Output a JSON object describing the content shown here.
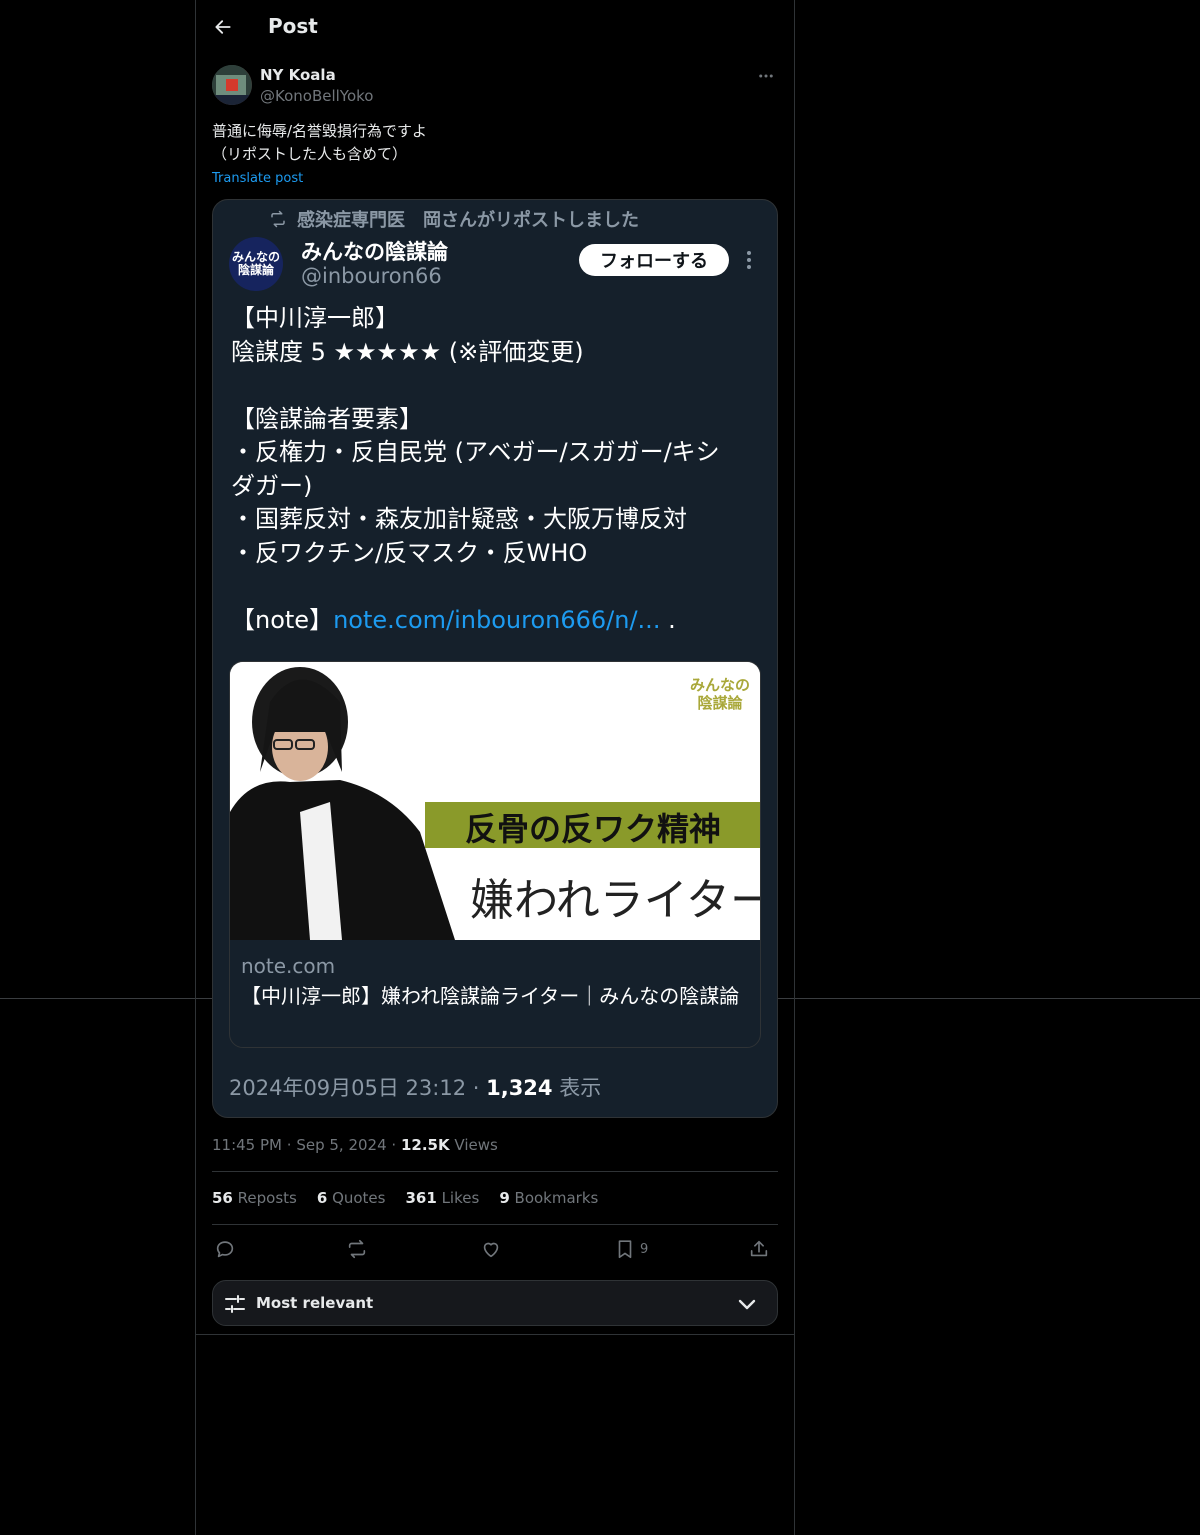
{
  "header": {
    "title": "Post"
  },
  "author": {
    "name": "NY Koala",
    "handle": "@KonoBellYoko"
  },
  "post": {
    "lines": [
      "普通に侮辱/名誉毀損行為ですよ",
      "（リポストした人も含めて）"
    ],
    "translate": "Translate post"
  },
  "screenshot": {
    "repost_label": "感染症専門医　岡さんがリポストしました",
    "avatar_text": "みんなの陰謀論",
    "name": "みんなの陰謀論",
    "handle": "@inbouron66",
    "follow": "フォローする",
    "text": {
      "l1": "【中川淳一郎】",
      "l2": "陰謀度 5 ★★★★★ (※評価変更)",
      "l3": "【陰謀論者要素】",
      "l4": "・反権力・反自民党 (アベガー/スガガー/キシ",
      "l5": "ダガー)",
      "l6": "・国葬反対・森友加計疑惑・大阪万博反対",
      "l7": "・反ワクチン/反マスク・反WHO",
      "note_prefix": "【note】",
      "note_link": "note.com/inbouron666/n/...",
      "note_suffix": " ."
    },
    "card": {
      "logo": "みんなの陰謀論",
      "banner": "反骨の反ワク精神",
      "subtitle": "嫌われライター",
      "domain": "note.com",
      "title": "【中川淳一郎】嫌われ陰謀論ライター｜みんなの陰謀論"
    },
    "meta": {
      "datetime": "2024年09月05日 23:12 · ",
      "views": "1,324",
      "views_label": " 表示"
    }
  },
  "meta": {
    "time": "11:45 PM",
    "date": "Sep 5, 2024",
    "views": "12.5K",
    "views_label": "Views",
    "sep": "·"
  },
  "stats": {
    "reposts": "56",
    "reposts_label": "Reposts",
    "quotes": "6",
    "quotes_label": "Quotes",
    "likes": "361",
    "likes_label": "Likes",
    "bookmarks": "9",
    "bookmarks_label": "Bookmarks"
  },
  "actions": {
    "bookmark_count": "9"
  },
  "sort": {
    "label": "Most relevant"
  },
  "icons": {
    "back": "arrow-left-icon",
    "more": "more-horizontal-icon",
    "repost": "repost-icon",
    "reply": "reply-icon",
    "like": "heart-icon",
    "bookmark": "bookmark-icon",
    "share": "share-icon",
    "filter": "sliders-icon",
    "chevron": "chevron-down-icon"
  },
  "colors": {
    "background": "#000000",
    "accent": "#1d9bf0",
    "screenshot_bg": "#15202b",
    "banner_green": "#8a9a2a"
  }
}
